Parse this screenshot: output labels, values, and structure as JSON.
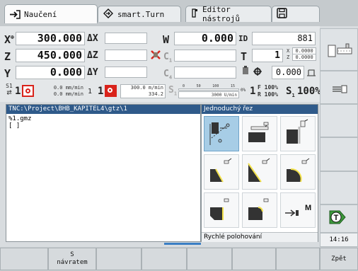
{
  "tabs": {
    "teach": "Naučení",
    "smart_turn": "smart.Turn",
    "tool_editor": "Editor nástrojů"
  },
  "position": {
    "x_label": "X",
    "x_value": "300.000",
    "x_delta": "ΔX",
    "z_label": "Z",
    "z_value": "450.000",
    "z_delta": "ΔZ",
    "y_label": "Y",
    "y_value": "0.000",
    "y_delta": "ΔY",
    "w_label": "W",
    "w_value": "0.000",
    "id_label": "ID",
    "id_value": "881",
    "c1_label": "C",
    "c1_sub": "1",
    "t_label": "T",
    "t_value": "1",
    "x_offset_label": "X",
    "x_offset_value": "0.0000",
    "z_offset_label": "Z",
    "z_offset_value": "0.0000",
    "c4_label": "C",
    "c4_sub": "4",
    "spindle_value": "0.000"
  },
  "feed": {
    "s_label": "S1",
    "s_num": "1",
    "f_line1": "0.0 mm/min",
    "f_line2": "0.0 mm/min",
    "num1": "1",
    "num2": "1",
    "f2_line1": "300.0 m/min",
    "f2_line2": "334.2",
    "s3_label": "S",
    "s3_num": "1",
    "bar_ticks": [
      "0",
      "50",
      "100",
      "15"
    ],
    "rpm": "3000 U/min",
    "pct_label": "0%",
    "f_pct": "F 100%",
    "r_pct": "R 100%",
    "s1_label": "S",
    "s1_num": "1",
    "s_pct": "100%",
    "one": "1"
  },
  "program": {
    "path": "TNC:\\Project\\BHB_KAPITEL4\\gtz\\1",
    "line1": "%1.gmz",
    "line2": "[ ]"
  },
  "menu": {
    "title": "Jednoduchý řez",
    "footer": "Rychlé polohování",
    "m_label": "M"
  },
  "side": {
    "time": "14:16"
  },
  "softkeys": {
    "s_return": "S",
    "s_return2": "návratem",
    "back": "Zpět"
  },
  "colors": {
    "header_blue": "#2f5a8a",
    "accent_green": "#3c9a3c",
    "alert_red": "#d9231b"
  }
}
